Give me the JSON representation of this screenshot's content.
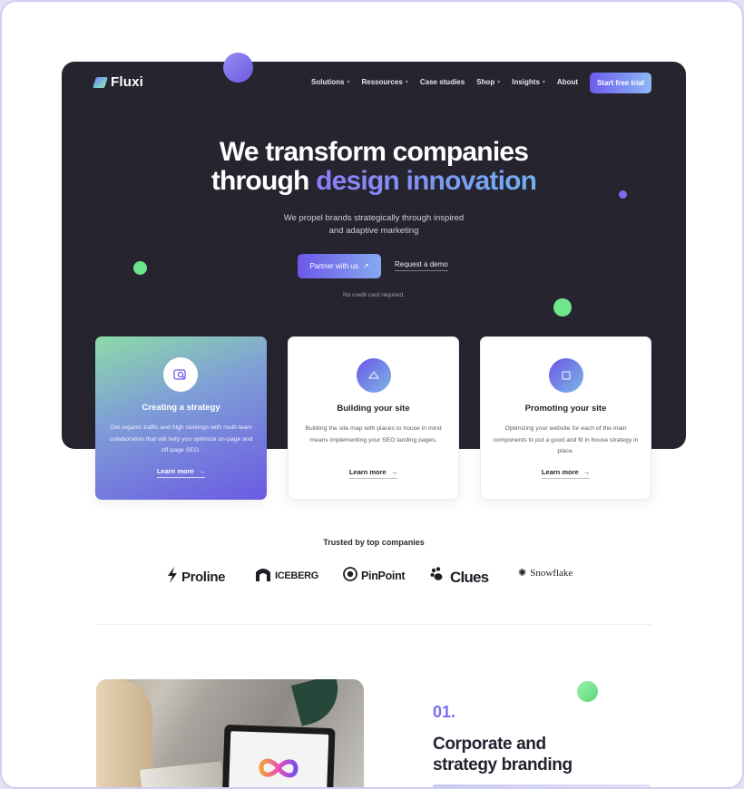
{
  "nav": {
    "logo": "Fluxi",
    "links": [
      {
        "label": "Solutions",
        "dropdown": true
      },
      {
        "label": "Ressources",
        "dropdown": true
      },
      {
        "label": "Case studies",
        "dropdown": false
      },
      {
        "label": "Shop",
        "dropdown": true
      },
      {
        "label": "Insights",
        "dropdown": true
      },
      {
        "label": "About",
        "dropdown": false
      }
    ],
    "cta": "Start free trial"
  },
  "hero": {
    "title_line1": "We transform companies",
    "title_line2_plain": "through ",
    "title_line2_accent": "design innovation",
    "subtitle_line1": "We propel brands strategically through inspired",
    "subtitle_line2": "and adaptive marketing",
    "primary_button": "Partner with us",
    "secondary_link": "Request a demo",
    "note": "No credit card required."
  },
  "cards": [
    {
      "icon": "search-image-icon",
      "title": "Creating a strategy",
      "description": "Get organic traffic and high rankings with multi-team collaboration that will help you optimize on-page and off-page SEO.",
      "link": "Learn more"
    },
    {
      "icon": "site-map-icon",
      "title": "Building your site",
      "description": "Building the site map with places to house in mind means implementing your SEO landing pages.",
      "link": "Learn more"
    },
    {
      "icon": "promote-icon",
      "title": "Promoting your site",
      "description": "Optimizing your website for each of the main components to put a good and fit in house strategy in place.",
      "link": "Learn more"
    }
  ],
  "trusted": {
    "heading": "Trusted by top companies",
    "brands": [
      "Proline",
      "ICEBERG",
      "PinPoint",
      "Clues",
      "Snowflake"
    ]
  },
  "feature": {
    "number": "01.",
    "title_line1": "Corporate and",
    "title_line2": "strategy branding"
  },
  "colors": {
    "hero_bg": "#25242f",
    "accent_purple": "#6a5cf0",
    "accent_blue": "#8fb8f4",
    "accent_green": "#70e58b"
  }
}
